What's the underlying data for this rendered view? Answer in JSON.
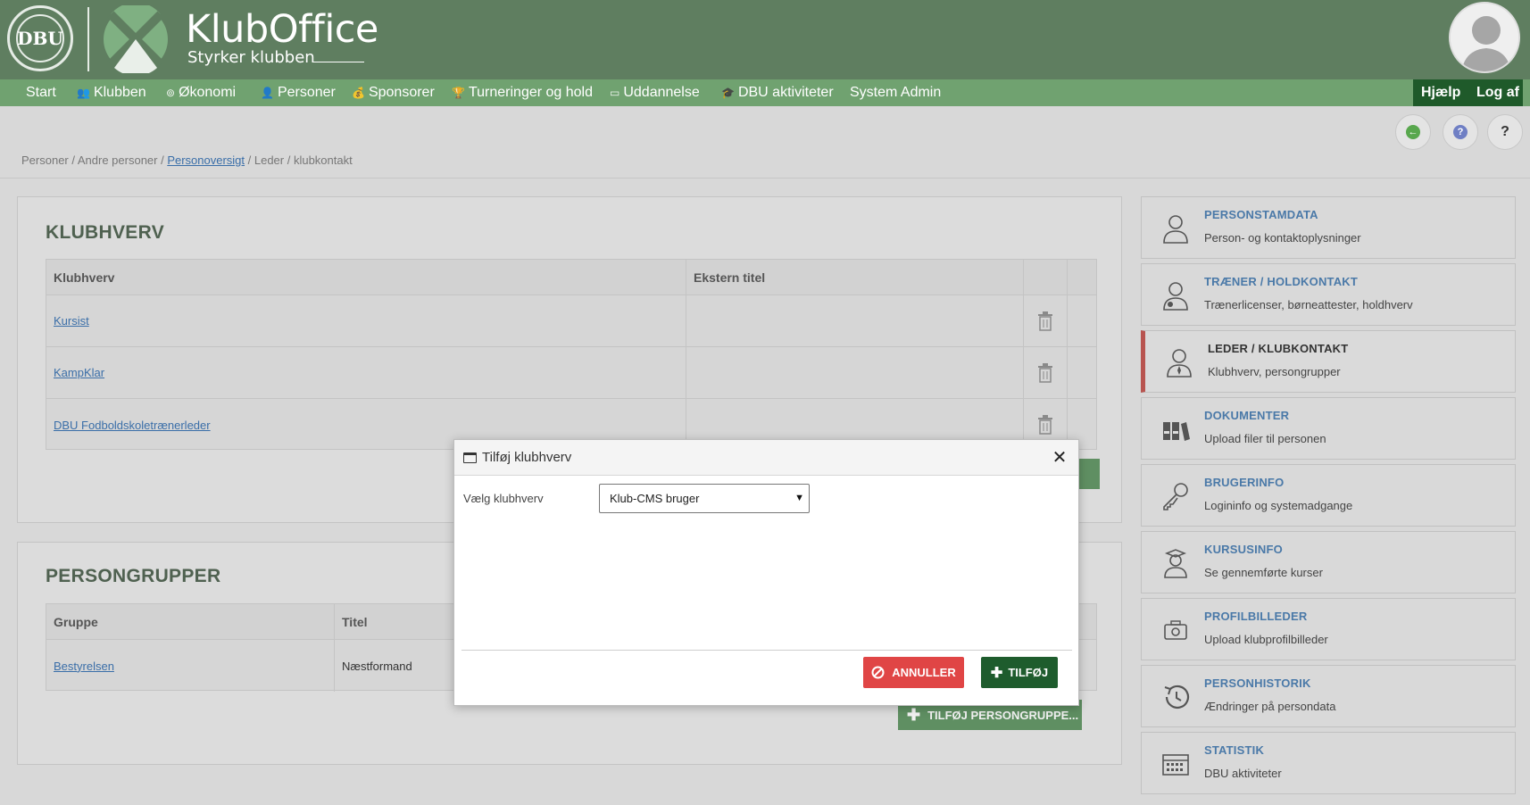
{
  "brand": {
    "seal_text": "DBU",
    "name": "KlubOffice",
    "tagline": "Styrker klubben"
  },
  "nav": {
    "items": [
      {
        "label": "Start",
        "icon": ""
      },
      {
        "label": "Klubben",
        "icon": "users-icon"
      },
      {
        "label": "Økonomi",
        "icon": "coins-icon"
      },
      {
        "label": "Personer",
        "icon": "person-icon"
      },
      {
        "label": "Sponsorer",
        "icon": "money-bag-icon"
      },
      {
        "label": "Turneringer og hold",
        "icon": "trophy-icon"
      },
      {
        "label": "Uddannelse",
        "icon": "presentation-icon"
      },
      {
        "label": "DBU aktiviteter",
        "icon": "graduation-cap-icon"
      },
      {
        "label": "System Admin",
        "icon": ""
      }
    ],
    "help": "Hjælp",
    "logout": "Log af"
  },
  "breadcrumb": {
    "part1": "Personer / Andre personer / ",
    "link": "Personoversigt",
    "part2": " / Leder / klubkontakt"
  },
  "klubhverv": {
    "title": "KLUBHVERV",
    "columns": [
      "Klubhverv",
      "Ekstern titel"
    ],
    "rows": [
      {
        "name": "Kursist",
        "ext": ""
      },
      {
        "name": "KampKlar",
        "ext": ""
      },
      {
        "name": "DBU Fodboldskoletrænerleder",
        "ext": ""
      }
    ]
  },
  "persongrupper": {
    "title": "PERSONGRUPPER",
    "columns": [
      "Gruppe",
      "Titel"
    ],
    "rows": [
      {
        "group": "Bestyrelsen",
        "title": "Næstformand"
      }
    ],
    "add_button": "TILFØJ PERSONGRUPPE..."
  },
  "sidebar": {
    "cards": [
      {
        "title": "PERSONSTAMDATA",
        "sub": "Person- og kontaktoplysninger",
        "icon": "person-outline-icon"
      },
      {
        "title": "TRÆNER / HOLDKONTAKT",
        "sub": "Trænerlicenser, børneattester, holdhverv",
        "icon": "coach-icon"
      },
      {
        "title": "LEDER / KLUBKONTAKT",
        "sub": "Klubhverv, persongrupper",
        "icon": "leader-icon"
      },
      {
        "title": "DOKUMENTER",
        "sub": "Upload filer til personen",
        "icon": "binders-icon"
      },
      {
        "title": "BRUGERINFO",
        "sub": "Logininfo og systemadgange",
        "icon": "key-icon"
      },
      {
        "title": "KURSUSINFO",
        "sub": "Se gennemførte kurser",
        "icon": "graduate-icon"
      },
      {
        "title": "PROFILBILLEDER",
        "sub": "Upload klubprofilbilleder",
        "icon": "camera-icon"
      },
      {
        "title": "PERSONHISTORIK",
        "sub": "Ændringer på persondata",
        "icon": "history-icon"
      },
      {
        "title": "STATISTIK",
        "sub": "DBU aktiviteter",
        "icon": "calendar-icon"
      }
    ]
  },
  "modal": {
    "title": "Tilføj klubhverv",
    "field_label": "Vælg klubhverv",
    "selected": "Klub-CMS bruger",
    "cancel": "ANNULLER",
    "add": "TILFØJ"
  },
  "colors": {
    "header": "#5f7e60",
    "nav": "#70a270",
    "nav_right": "#1f5a2a",
    "link": "#3a6ea8",
    "danger": "#e04545",
    "primary": "#1e5c2d",
    "active_marker": "#b85450"
  }
}
